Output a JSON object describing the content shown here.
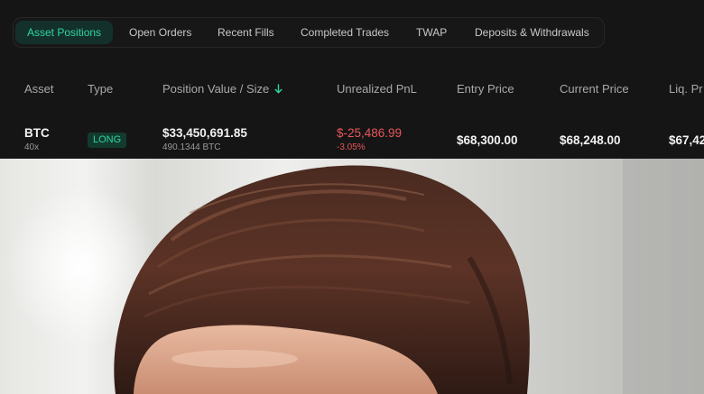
{
  "tabs": [
    {
      "label": "Asset Positions",
      "active": true
    },
    {
      "label": "Open Orders",
      "active": false
    },
    {
      "label": "Recent Fills",
      "active": false
    },
    {
      "label": "Completed Trades",
      "active": false
    },
    {
      "label": "TWAP",
      "active": false
    },
    {
      "label": "Deposits & Withdrawals",
      "active": false
    }
  ],
  "columns": {
    "asset": "Asset",
    "type": "Type",
    "position_value": "Position Value / Size",
    "unrealized_pnl": "Unrealized PnL",
    "entry_price": "Entry Price",
    "current_price": "Current Price",
    "liq_price": "Liq. Pr"
  },
  "sort_icon": "arrow-down-icon",
  "position": {
    "asset": "BTC",
    "leverage": "40x",
    "type": "LONG",
    "position_value": "$33,450,691.85",
    "size": "490.1344 BTC",
    "pnl": "$-25,486.99",
    "pnl_pct": "-3.05%",
    "entry_price": "$68,300.00",
    "current_price": "$68,248.00",
    "liq_price": "$67,42"
  },
  "colors": {
    "accent": "#2fd6a0",
    "negative": "#e8565b",
    "panel_bg": "#151515"
  }
}
